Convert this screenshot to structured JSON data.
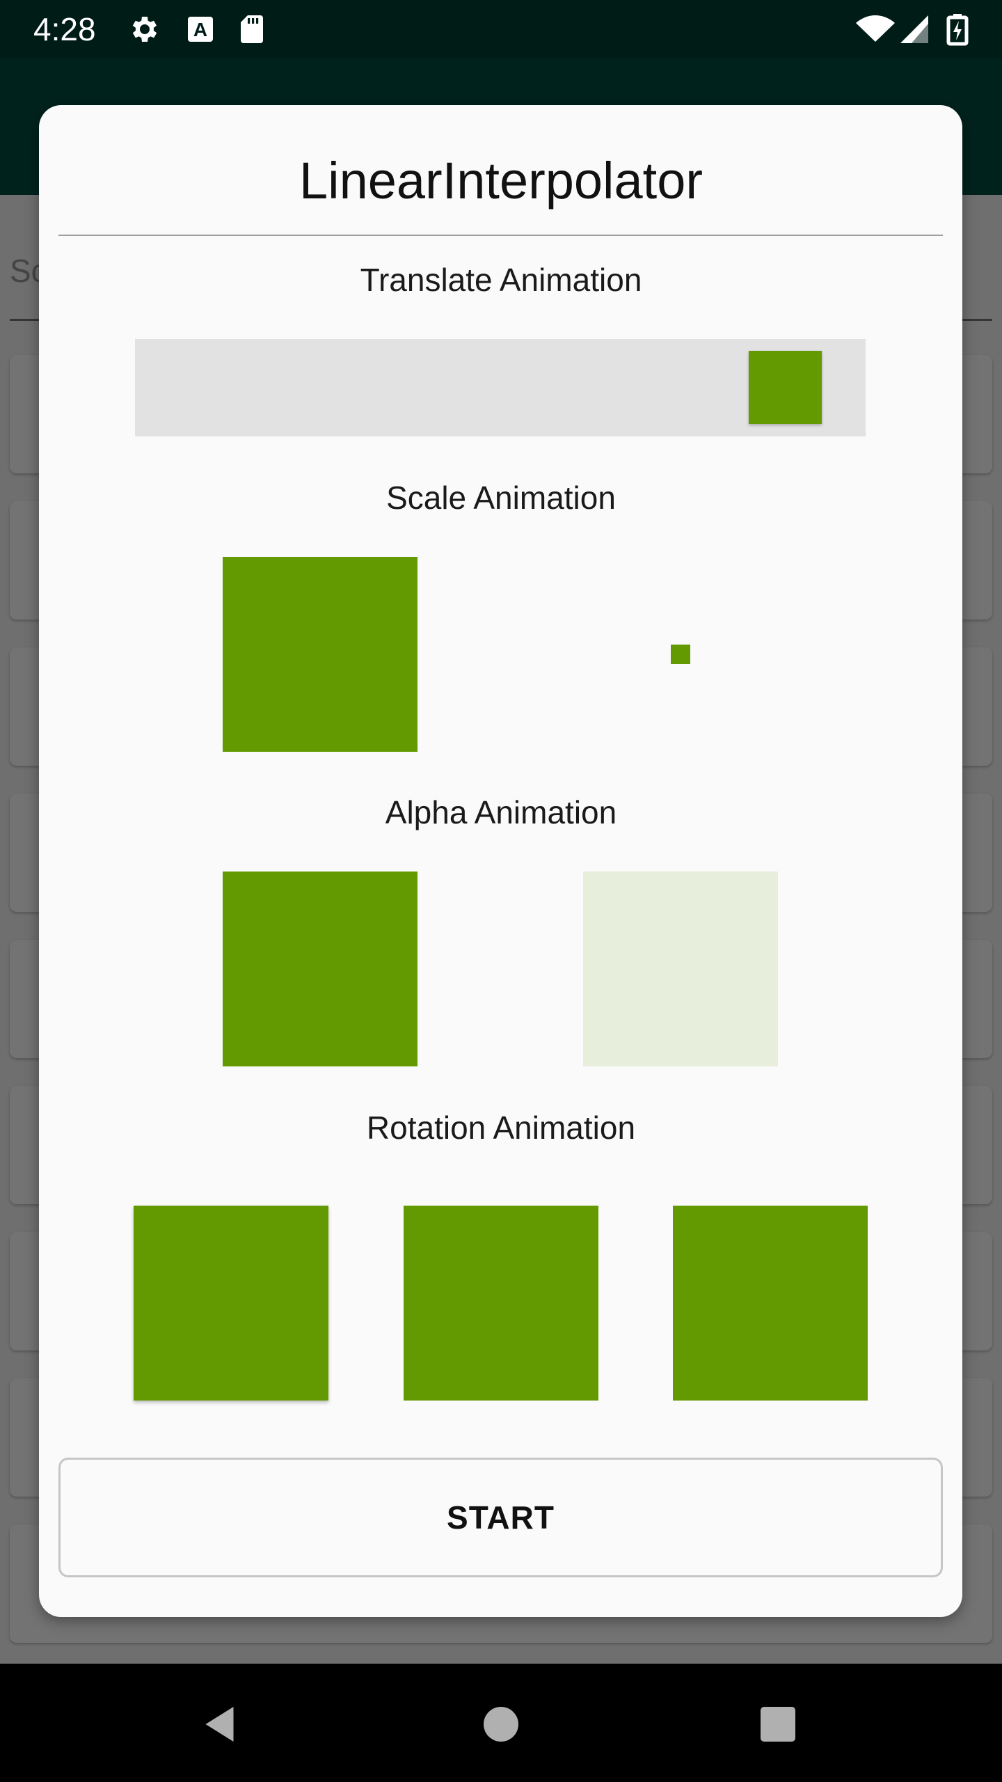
{
  "status_bar": {
    "time": "4:28",
    "icons": [
      "gear-icon",
      "text-a-icon",
      "sd-card-icon",
      "wifi-icon",
      "cell-signal-icon",
      "battery-charging-icon"
    ]
  },
  "background": {
    "search_text": "Sc"
  },
  "dialog": {
    "title": "LinearInterpolator",
    "sections": {
      "translate": {
        "label": "Translate Animation",
        "progress": 0.95
      },
      "scale": {
        "label": "Scale Animation",
        "left_scale": 1.0,
        "right_scale": 0.1
      },
      "alpha": {
        "label": "Alpha Animation",
        "left_alpha": 1.0,
        "right_alpha": 0.12
      },
      "rotation": {
        "label": "Rotation Animation"
      }
    },
    "start_label": "START"
  },
  "colors": {
    "accent_green": "#639a02",
    "status_bar": "#001c17",
    "app_bar": "#004d40"
  },
  "nav_bar": {
    "icons": [
      "back-icon",
      "home-icon",
      "recents-icon"
    ]
  }
}
